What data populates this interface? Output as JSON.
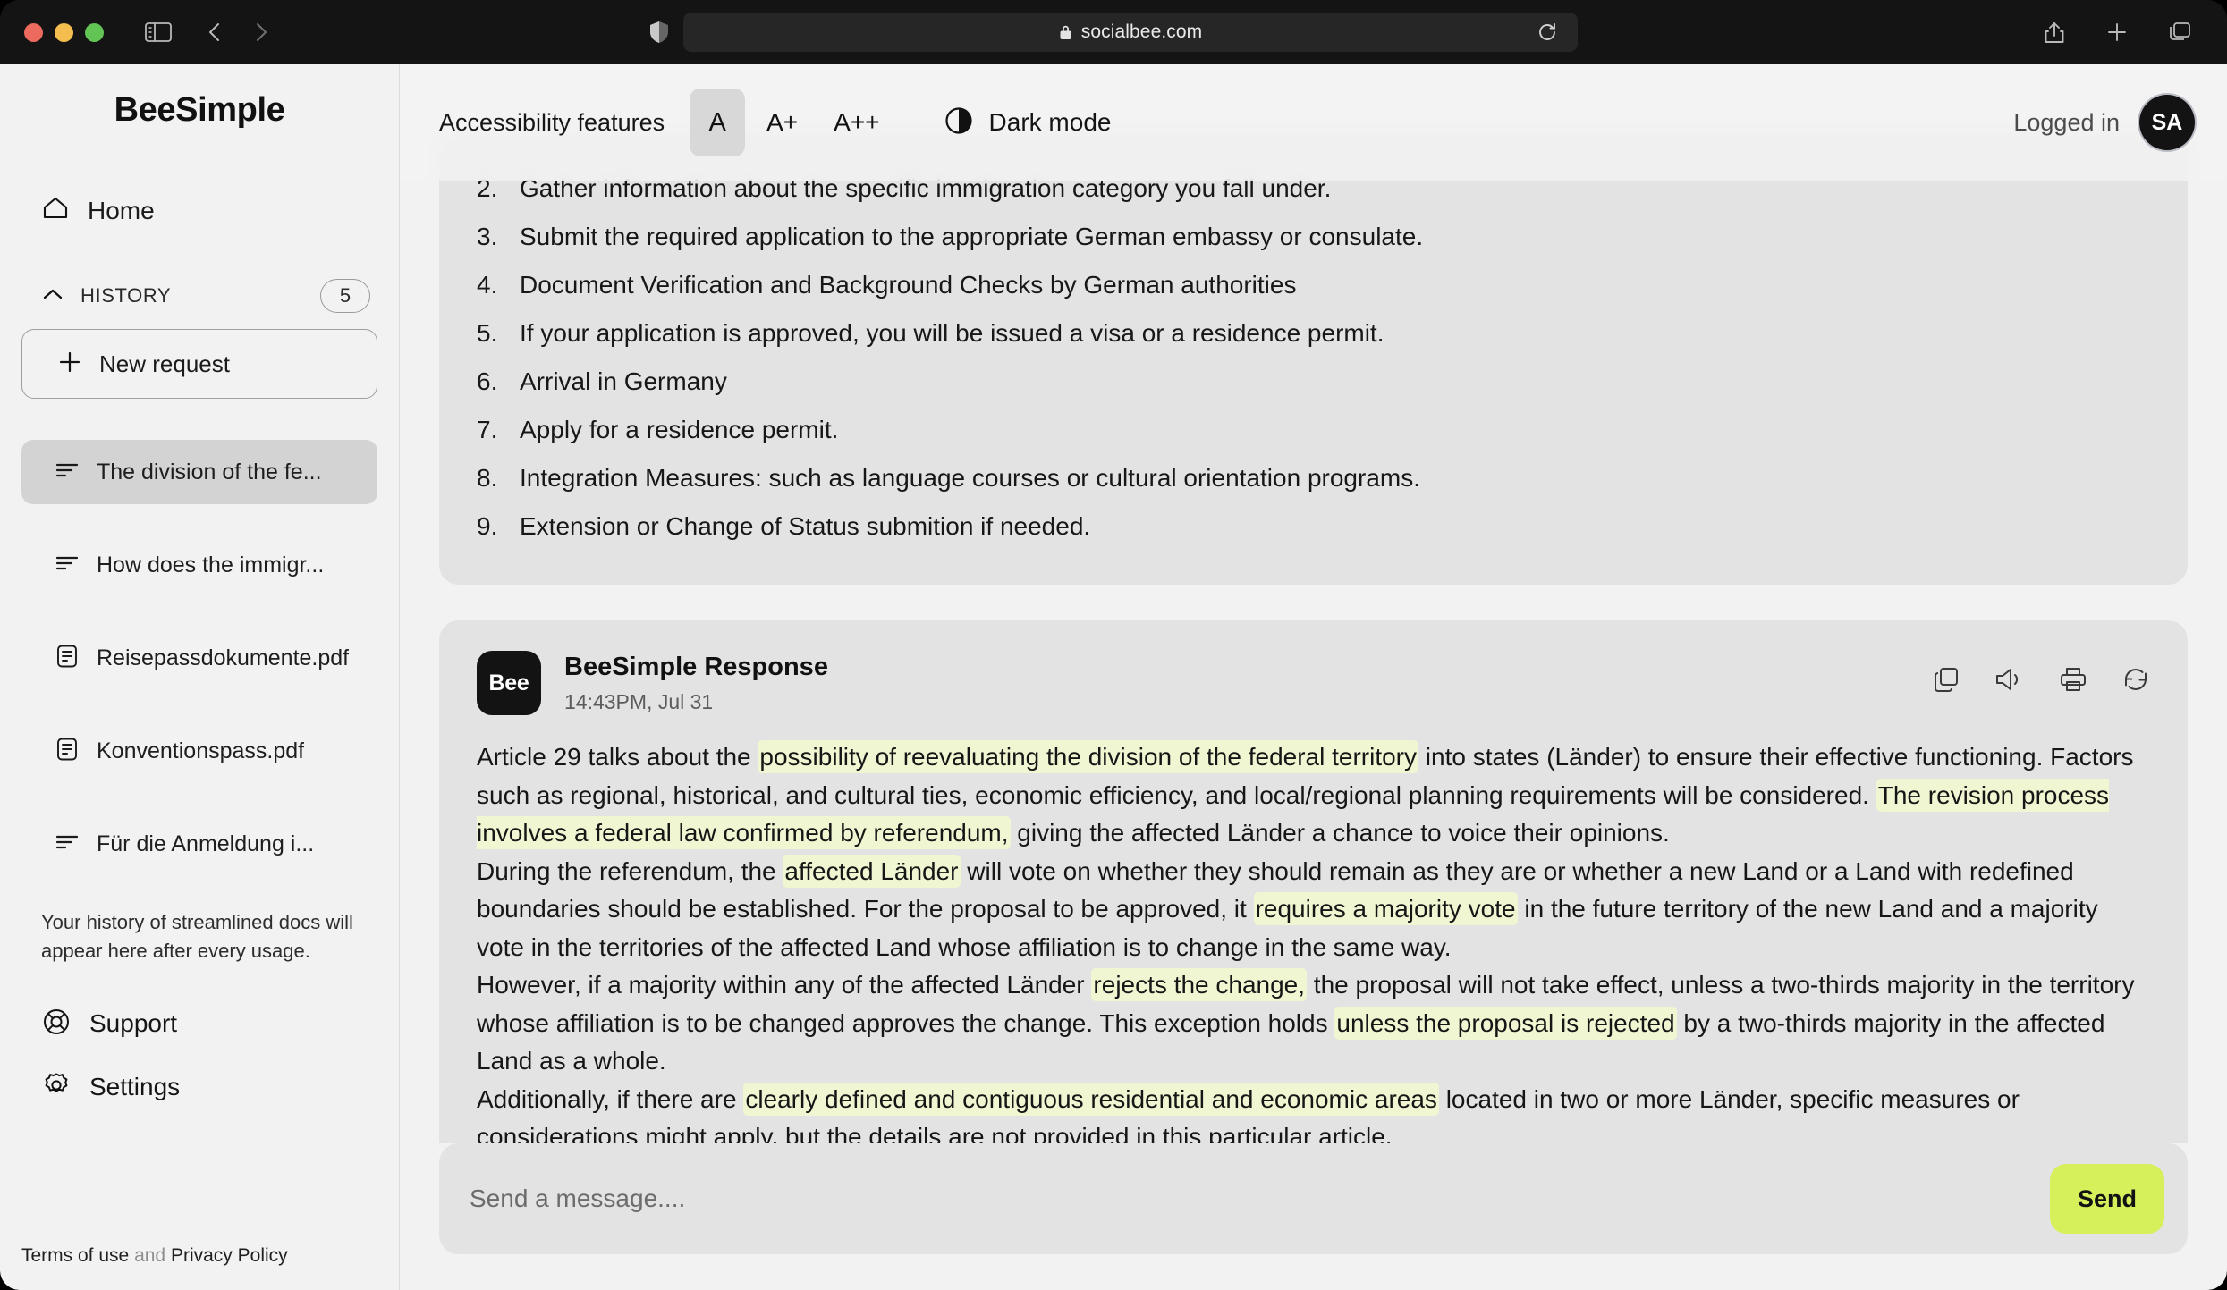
{
  "browser": {
    "url": "socialbee.com",
    "icons": {
      "sidebar_toggle": "sidebar-toggle-icon",
      "back": "back-arrow-icon",
      "forward": "forward-arrow-icon",
      "shield": "privacy-shield-icon",
      "lock": "lock-icon",
      "reload": "reload-icon",
      "share": "share-icon",
      "new_tab": "plus-icon",
      "tabs": "tab-overview-icon"
    }
  },
  "sidebar": {
    "brand": "BeeSimple",
    "home_label": "Home",
    "history_title": "HISTORY",
    "history_count": "5",
    "new_request_label": "New request",
    "history_items": [
      {
        "label": "The division of the fe...",
        "icon": "text-lines-icon",
        "active": true
      },
      {
        "label": "How does the immigr...",
        "icon": "text-lines-icon",
        "active": false
      },
      {
        "label": "Reisepassdokumente.pdf",
        "icon": "document-icon",
        "active": false
      },
      {
        "label": "Konventionspass.pdf",
        "icon": "document-icon",
        "active": false
      },
      {
        "label": "Für die Anmeldung i...",
        "icon": "text-lines-icon",
        "active": false
      }
    ],
    "history_note": "Your history of streamlined docs will appear here after every usage.",
    "support_label": "Support",
    "settings_label": "Settings",
    "legal": {
      "terms": "Terms of use",
      "and": "and",
      "privacy": "Privacy Policy"
    }
  },
  "accessibility": {
    "label": "Accessibility features",
    "sizes": [
      {
        "label": "A",
        "active": true
      },
      {
        "label": "A+",
        "active": false
      },
      {
        "label": "A++",
        "active": false
      }
    ],
    "dark_mode_label": "Dark mode",
    "logged_in_label": "Logged in",
    "avatar_initials": "SA"
  },
  "conversation": {
    "steps_card": {
      "items": [
        {
          "num": "2.",
          "text": "Gather information about the specific immigration category you fall under."
        },
        {
          "num": "3.",
          "text": "Submit the required application to the appropriate German  embassy or consulate."
        },
        {
          "num": "4.",
          "text": "Document Verification and Background Checks by German authorities"
        },
        {
          "num": "5.",
          "text": "If your application is approved, you will be issued a visa or a residence permit."
        },
        {
          "num": "6.",
          "text": "Arrival in Germany"
        },
        {
          "num": "7.",
          "text": "Apply for a residence permit."
        },
        {
          "num": "8.",
          "text": "Integration Measures: such as language courses or cultural orientation programs."
        },
        {
          "num": "9.",
          "text": "Extension or Change of Status submition if needed."
        }
      ]
    },
    "response": {
      "avatar_text": "Bee",
      "title": "BeeSimple Response",
      "timestamp": "14:43PM, Jul 31",
      "actions": [
        {
          "name": "copy-icon"
        },
        {
          "name": "speaker-icon"
        },
        {
          "name": "print-icon"
        },
        {
          "name": "regenerate-icon"
        }
      ],
      "paragraphs": [
        [
          {
            "t": "Article 29 talks about the ",
            "h": false
          },
          {
            "t": "possibility of reevaluating the division of the federal territory",
            "h": true
          },
          {
            "t": " into states (Länder) to ensure their effective functioning. Factors such as regional, historical, and cultural ties, economic efficiency, and local/regional planning requirements will be considered. ",
            "h": false
          },
          {
            "t": "The revision process involves a federal law confirmed by referendum,",
            "h": true
          },
          {
            "t": " giving the affected Länder a chance to voice their opinions.",
            "h": false
          }
        ],
        [
          {
            "t": "During the referendum, the ",
            "h": false
          },
          {
            "t": "affected Länder",
            "h": true
          },
          {
            "t": " will vote on whether they should remain as they are or whether a new Land or a Land with redefined boundaries should be established. For the proposal to be approved, it ",
            "h": false
          },
          {
            "t": "requires a majority vote",
            "h": true
          },
          {
            "t": " in the future territory of the new Land and a majority vote in the territories of the affected Land whose affiliation is to change in the same way.",
            "h": false
          }
        ],
        [
          {
            "t": "However, if a majority within any of the affected Länder ",
            "h": false
          },
          {
            "t": "rejects the change,",
            "h": true
          },
          {
            "t": " the proposal will not take effect, unless a two-thirds majority in the territory whose affiliation is to be changed approves the change. This exception holds ",
            "h": false
          },
          {
            "t": "unless the proposal is rejected",
            "h": true
          },
          {
            "t": " by a two-thirds majority in the affected Land as a whole.",
            "h": false
          }
        ],
        [
          {
            "t": "Additionally, if there are ",
            "h": false
          },
          {
            "t": "clearly defined and contiguous residential and economic areas",
            "h": true
          },
          {
            "t": " located in two or more Länder, specific measures or considerations might apply, but the details are not provided in this particular article.",
            "h": false
          }
        ]
      ]
    }
  },
  "composer": {
    "placeholder": "Send a message....",
    "value": "",
    "send_label": "Send"
  },
  "colors": {
    "accent": "#d6f05c",
    "highlight": "#f1f6d2",
    "page_bg": "#f2f2f2",
    "card_bg": "#e3e3e3",
    "chrome_bg": "#141414"
  }
}
